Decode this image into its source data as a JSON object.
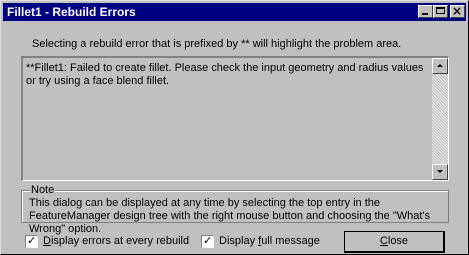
{
  "window": {
    "title": "Fillet1 - Rebuild Errors",
    "controls": {
      "minimize": "minimize-icon",
      "maximize": "maximize-icon",
      "close": "close-icon",
      "close_glyph": "×"
    }
  },
  "instruction": "Selecting a rebuild error that is prefixed by ** will highlight the problem area.",
  "errors": [
    {
      "text": "**Fillet1: Failed to create fillet.  Please check the input geometry and radius values or try using a face blend fillet."
    }
  ],
  "note": {
    "legend": "Note",
    "text": "This dialog can be displayed at any time by selecting the top entry in the FeatureManager design tree with the right mouse button and choosing the \"What's Wrong\" option."
  },
  "options": {
    "display_errors": {
      "hotkey": "D",
      "rest": "isplay errors at every rebuild",
      "checked": true,
      "mark": "✓"
    },
    "display_full": {
      "prefix": "Display ",
      "hotkey": "f",
      "rest": "ull message",
      "checked": true,
      "mark": "✓"
    }
  },
  "buttons": {
    "close_hotkey": "C",
    "close_rest": "lose"
  }
}
